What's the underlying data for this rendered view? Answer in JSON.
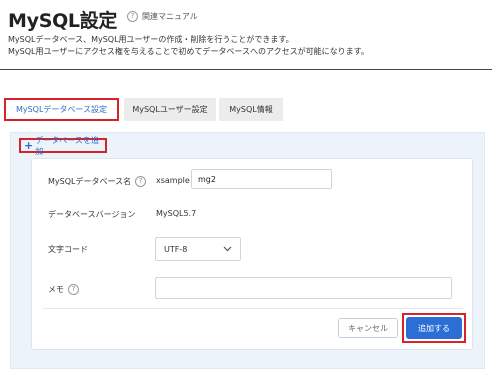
{
  "header": {
    "title": "MySQL設定",
    "help_link": "関連マニュアル",
    "desc_line1": "MySQLデータベース、MySQL用ユーザーの作成・削除を行うことができます。",
    "desc_line2": "MySQL用ユーザーにアクセス権を与えることで初めてデータベースへのアクセスが可能になります。"
  },
  "tabs": [
    {
      "label": "MySQLデータベース設定",
      "active": true
    },
    {
      "label": "MySQLユーザー設定",
      "active": false
    },
    {
      "label": "MySQL情報",
      "active": false
    }
  ],
  "add_link": "データベースを追加",
  "form": {
    "name_label": "MySQLデータベース名",
    "name_prefix": "xsample",
    "name_value": "mg2",
    "version_label": "データベースバージョン",
    "version_value": "MySQL5.7",
    "charset_label": "文字コード",
    "charset_value": "UTF-8",
    "memo_label": "メモ",
    "memo_value": "",
    "cancel_label": "キャンセル",
    "submit_label": "追加する"
  },
  "colors": {
    "accent": "#2b6fd6",
    "link": "#2f6cc4",
    "highlight": "#d6232a",
    "panel_bg": "#edf3fb"
  }
}
